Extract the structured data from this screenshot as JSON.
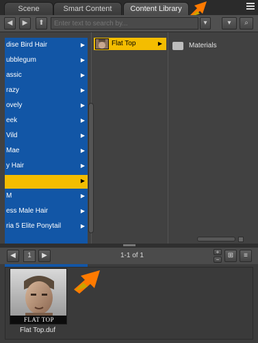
{
  "tabs": [
    {
      "label": "Scene"
    },
    {
      "label": "Smart Content"
    },
    {
      "label": "Content Library"
    }
  ],
  "toolbar": {
    "search_placeholder": "Enter text to search by..."
  },
  "list": {
    "items": [
      {
        "label": "dise Bird Hair"
      },
      {
        "label": "ubblegum"
      },
      {
        "label": "assic"
      },
      {
        "label": "razy"
      },
      {
        "label": "ovely"
      },
      {
        "label": "eek"
      },
      {
        "label": "Vild"
      },
      {
        "label": "Mae"
      },
      {
        "label": "y Hair"
      },
      {
        "label": ""
      },
      {
        "label": "M"
      },
      {
        "label": "ess Male Hair"
      },
      {
        "label": "ria 5 Elite Ponytail"
      }
    ],
    "selected_index": 9
  },
  "subitem": {
    "label": "Flat Top"
  },
  "folder": {
    "label": "Materials"
  },
  "pager": {
    "page": "1",
    "count": "1-1 of 1"
  },
  "content": {
    "item_caption": "FLAT TOP",
    "item_file": "Flat Top.duf"
  },
  "colors": {
    "selection": "#f4bd00",
    "list_bg": "#1256a6",
    "arrow": "#ff7a00"
  }
}
